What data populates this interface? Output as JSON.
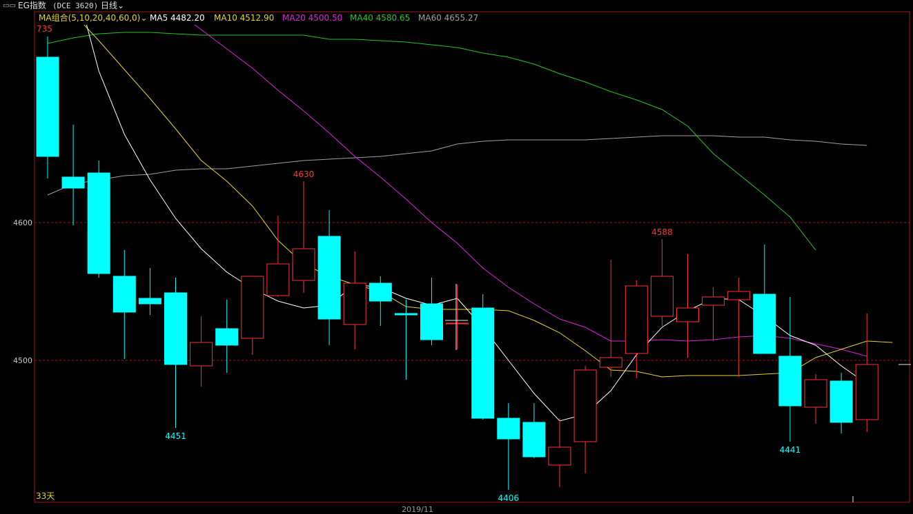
{
  "header": {
    "title": "EG指数",
    "code": "(DCE 3620)",
    "period": "日线",
    "period_chevron": "⌄"
  },
  "ma_legend": {
    "label": "MA组合(5,10,20,40,60,0)",
    "chevron": "⌄",
    "items": [
      {
        "text": "MA5 4482.20",
        "color": "#ffffff"
      },
      {
        "text": "MA10 4512.90",
        "color": "#e5d620"
      },
      {
        "text": "MA20 4500.50",
        "color": "#e020e0"
      },
      {
        "text": "MA40 4580.65",
        "color": "#20c820"
      },
      {
        "text": "MA60 4655.27",
        "color": "#a0a0a0"
      }
    ]
  },
  "footer": {
    "date_label": "2019/11",
    "days_label": "33天"
  },
  "colors": {
    "up": "#ff3232",
    "down": "#00ffff",
    "grid": "#a01818",
    "frame": "#a01818",
    "ma5": "#ffffff",
    "ma10": "#e5d620",
    "ma20": "#e020e0",
    "ma40": "#20c820",
    "ma60": "#a0a0a0"
  },
  "chart_data": {
    "type": "candlestick",
    "y_ticks": [
      4500,
      4600
    ],
    "ylim": [
      4401,
      4748
    ],
    "top_clipped_label": "735",
    "annotations": [
      {
        "text": "4630",
        "index": 10,
        "value": 4630,
        "kind": "high"
      },
      {
        "text": "4451",
        "index": 5,
        "value": 4451,
        "kind": "low"
      },
      {
        "text": "4406",
        "index": 18,
        "value": 4406,
        "kind": "low"
      },
      {
        "text": "4588",
        "index": 24,
        "value": 4588,
        "kind": "high"
      },
      {
        "text": "4441",
        "index": 29,
        "value": 4441,
        "kind": "low"
      }
    ],
    "candles": [
      {
        "o": 4720,
        "h": 4735,
        "l": 4632,
        "c": 4648
      },
      {
        "o": 4633,
        "h": 4671,
        "l": 4598,
        "c": 4625
      },
      {
        "o": 4636,
        "h": 4645,
        "l": 4560,
        "c": 4563
      },
      {
        "o": 4561,
        "h": 4580,
        "l": 4501,
        "c": 4535
      },
      {
        "o": 4545,
        "h": 4567,
        "l": 4533,
        "c": 4541
      },
      {
        "o": 4549,
        "h": 4560,
        "l": 4451,
        "c": 4497
      },
      {
        "o": 4496,
        "h": 4532,
        "l": 4481,
        "c": 4513
      },
      {
        "o": 4523,
        "h": 4544,
        "l": 4491,
        "c": 4511
      },
      {
        "o": 4516,
        "h": 4561,
        "l": 4504,
        "c": 4561
      },
      {
        "o": 4547,
        "h": 4605,
        "l": 4546,
        "c": 4570
      },
      {
        "o": 4558,
        "h": 4630,
        "l": 4549,
        "c": 4581
      },
      {
        "o": 4590,
        "h": 4609,
        "l": 4511,
        "c": 4530
      },
      {
        "o": 4526,
        "h": 4579,
        "l": 4508,
        "c": 4556
      },
      {
        "o": 4556,
        "h": 4561,
        "l": 4525,
        "c": 4543
      },
      {
        "o": 4534,
        "h": 4544,
        "l": 4486,
        "c": 4533
      },
      {
        "o": 4541,
        "h": 4560,
        "l": 4511,
        "c": 4515
      },
      {
        "o": 4527,
        "h": 4555,
        "l": 4508,
        "c": 4527
      },
      {
        "o": 4538,
        "h": 4548,
        "l": 4457,
        "c": 4458
      },
      {
        "o": 4458,
        "h": 4469,
        "l": 4406,
        "c": 4443
      },
      {
        "o": 4455,
        "h": 4469,
        "l": 4429,
        "c": 4430
      },
      {
        "o": 4424,
        "h": 4458,
        "l": 4408,
        "c": 4437
      },
      {
        "o": 4441,
        "h": 4496,
        "l": 4418,
        "c": 4493
      },
      {
        "o": 4495,
        "h": 4573,
        "l": 4488,
        "c": 4502
      },
      {
        "o": 4505,
        "h": 4558,
        "l": 4487,
        "c": 4554
      },
      {
        "o": 4532,
        "h": 4588,
        "l": 4525,
        "c": 4561
      },
      {
        "o": 4528,
        "h": 4577,
        "l": 4502,
        "c": 4538
      },
      {
        "o": 4540,
        "h": 4553,
        "l": 4514,
        "c": 4546
      },
      {
        "o": 4544,
        "h": 4560,
        "l": 4488,
        "c": 4550
      },
      {
        "o": 4548,
        "h": 4584,
        "l": 4505,
        "c": 4505
      },
      {
        "o": 4503,
        "h": 4546,
        "l": 4441,
        "c": 4467
      },
      {
        "o": 4466,
        "h": 4490,
        "l": 4454,
        "c": 4486
      },
      {
        "o": 4485,
        "h": 4491,
        "l": 4447,
        "c": 4455
      },
      {
        "o": 4457,
        "h": 4534,
        "l": 4448,
        "c": 4497
      }
    ],
    "ma5": [
      null,
      4780,
      4710,
      4664,
      4631,
      4603,
      4581,
      4564,
      4552,
      4543,
      4538,
      4540,
      4555,
      4553,
      4545,
      4540,
      4545,
      4524,
      4500,
      4476,
      4456,
      4461,
      4478,
      4504,
      4524,
      4536,
      4545,
      4544,
      4532,
      4518,
      4511,
      4496,
      4483
    ],
    "ma10": [
      4775,
      4752,
      4732,
      4711,
      4690,
      4668,
      4645,
      4630,
      4612,
      4587,
      4570,
      4561,
      4555,
      4550,
      4539,
      4537,
      4537,
      4537,
      4536,
      4529,
      4520,
      4507,
      4493,
      4492,
      4488,
      4489,
      4489,
      4489,
      4490,
      4491,
      4502,
      4508,
      4514,
      4513
    ],
    "ma20": [
      4812,
      4800,
      4790,
      4779,
      4766,
      4754,
      4740,
      4726,
      4712,
      4696,
      4681,
      4665,
      4648,
      4633,
      4617,
      4600,
      4585,
      4567,
      4553,
      4541,
      4530,
      4524,
      4514,
      4514,
      4515,
      4514,
      4515,
      4517,
      4518,
      4516,
      4512,
      4508,
      4503
    ],
    "ma40": [
      4730,
      4734,
      4737,
      4738,
      4738,
      4737,
      4736,
      4736,
      4736,
      4736,
      4736,
      4733,
      4733,
      4732,
      4731,
      4729,
      4727,
      4723,
      4720,
      4715,
      4708,
      4702,
      4695,
      4689,
      4682,
      4670,
      4650,
      4635,
      4620,
      4604,
      4580
    ],
    "ma40_start": 0,
    "ma60": [
      4620,
      4628,
      4631,
      4634,
      4635,
      4638,
      4639,
      4639,
      4641,
      4643,
      4645,
      4646,
      4647,
      4648,
      4650,
      4652,
      4657,
      4659,
      4660,
      4660,
      4660,
      4660,
      4661,
      4662,
      4663,
      4663,
      4663,
      4662,
      4662,
      4660,
      4659,
      4657,
      4656
    ]
  }
}
